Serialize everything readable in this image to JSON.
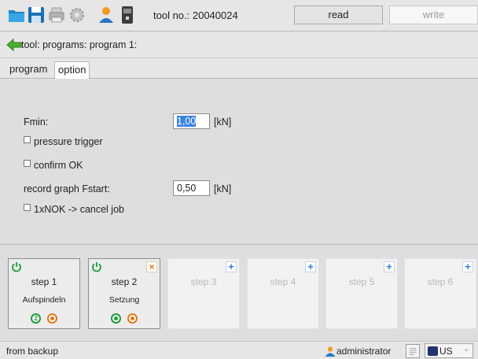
{
  "toolbar": {
    "tool_label": "tool no.: 20040024",
    "read_label": "read",
    "write_label": "write",
    "icons": [
      "open-folder-icon",
      "save-icon",
      "print-icon",
      "settings-icon",
      "user-icon",
      "device-icon"
    ]
  },
  "breadcrumb": {
    "text": "tool: programs: program 1:"
  },
  "tabs": [
    {
      "label": "program",
      "active": false
    },
    {
      "label": "option",
      "active": true
    }
  ],
  "form": {
    "fmin": {
      "label": "Fmin:",
      "value": "1,00",
      "unit": "[kN]"
    },
    "pressure_trigger": {
      "label": "pressure trigger",
      "checked": false
    },
    "confirm_ok": {
      "label": "confirm OK",
      "checked": false
    },
    "record_graph": {
      "label": "record graph Fstart:",
      "value": "0,50",
      "unit": "[kN]"
    },
    "nok_cancel": {
      "label": "1xNOK -> cancel job",
      "checked": false
    }
  },
  "steps": [
    {
      "name": "step 1",
      "desc": "Aufspindeln",
      "active": true,
      "corner": "power-icon",
      "indicator_num": "2"
    },
    {
      "name": "step 2",
      "desc": "Setzung",
      "active": true,
      "corner": "power-icon"
    },
    {
      "name": "step 3",
      "desc": "",
      "active": false
    },
    {
      "name": "step 4",
      "desc": "",
      "active": false
    },
    {
      "name": "step 5",
      "desc": "",
      "active": false
    },
    {
      "name": "step 6",
      "desc": "",
      "active": false
    }
  ],
  "status": {
    "source": "from backup",
    "user": "administrator",
    "language": "US"
  },
  "colors": {
    "accent_blue": "#3a84e0",
    "green": "#1e9a3c",
    "orange": "#e07a1c"
  }
}
